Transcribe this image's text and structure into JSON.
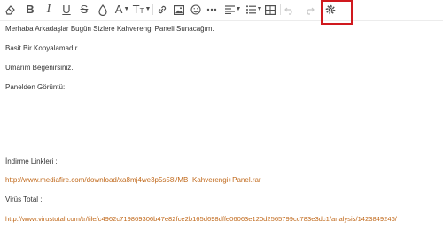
{
  "toolbar": {
    "items": [
      {
        "name": "eraser-icon",
        "label": ""
      },
      {
        "name": "bold-button",
        "label": "B"
      },
      {
        "name": "italic-button",
        "label": "I"
      },
      {
        "name": "underline-button",
        "label": "U"
      },
      {
        "name": "strikethrough-button",
        "label": "S"
      },
      {
        "name": "color-drop-icon",
        "label": ""
      },
      {
        "name": "font-family-button",
        "label": "A"
      },
      {
        "name": "font-size-button",
        "label": "T"
      },
      {
        "name": "link-icon",
        "label": ""
      },
      {
        "name": "image-icon",
        "label": ""
      },
      {
        "name": "emoji-icon",
        "label": ""
      },
      {
        "name": "more-options-icon",
        "label": ""
      },
      {
        "name": "align-icon",
        "label": ""
      },
      {
        "name": "list-icon",
        "label": ""
      },
      {
        "name": "table-icon",
        "label": ""
      },
      {
        "name": "undo-icon",
        "label": ""
      },
      {
        "name": "redo-icon",
        "label": ""
      },
      {
        "name": "settings-gear-icon",
        "label": ""
      }
    ],
    "highlight_color": "#d0191e"
  },
  "content": {
    "line1": "Merhaba Arkadaşlar Bugün Sizlere Kahverengi Paneli Sunacağım.",
    "line2": "Basit Bir Kopyalamadır.",
    "line3": "Umarım Beğenirsiniz.",
    "line4": "Panelden Görüntü:",
    "download_label": "İndirme Linkleri :",
    "download_link": "http://www.mediafire.com/download/xa8mj4we3p5s58i/MB+Kahverengi+Panel.rar",
    "virus_label": "Virüs Total :",
    "virus_link": "http://www.virustotal.com/tr/file/c4962c719869306b47e82fce2b165d698dffe06063e120d2565799cc783e3dc1/analysis/1423849246/",
    "link_color": "#c0681a",
    "text_color": "#333333"
  }
}
